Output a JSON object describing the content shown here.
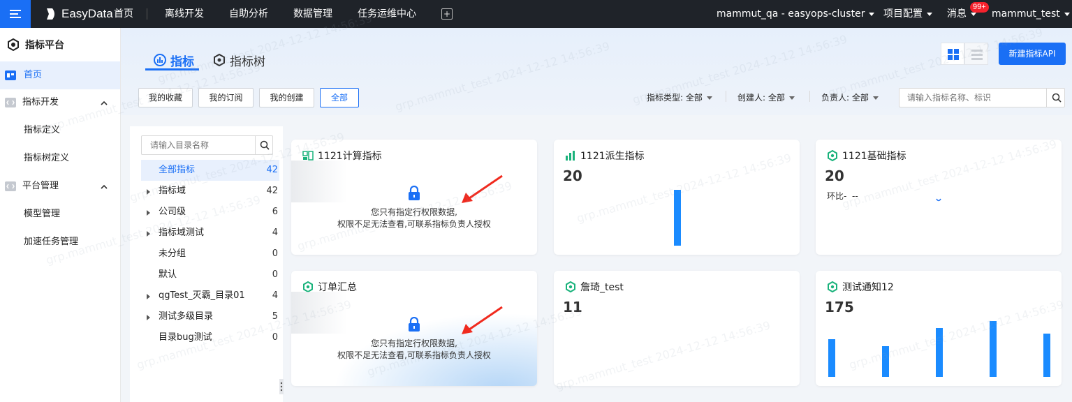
{
  "topbar": {
    "logo": "EasyData",
    "nav": [
      "首页",
      "离线开发",
      "自助分析",
      "数据管理",
      "任务运维中心"
    ],
    "cluster": "mammut_qa - easyops-cluster",
    "project_config": "项目配置",
    "messages": "消息",
    "message_badge": "99+",
    "user": "mammut_test"
  },
  "sidebar": {
    "title": "指标平台",
    "items": [
      {
        "label": "首页"
      },
      {
        "label": "指标开发"
      },
      {
        "label": "指标定义"
      },
      {
        "label": "指标树定义"
      },
      {
        "label": "平台管理"
      },
      {
        "label": "模型管理"
      },
      {
        "label": "加速任务管理"
      }
    ]
  },
  "tabs": [
    "指标",
    "指标树"
  ],
  "new_api_button": "新建指标API",
  "filters": {
    "buttons": [
      "我的收藏",
      "我的订阅",
      "我的创建",
      "全部"
    ],
    "selected": "全部",
    "dropdowns": [
      {
        "label": "指标类型:",
        "value": "全部"
      },
      {
        "label": "创建人:",
        "value": "全部"
      },
      {
        "label": "负责人:",
        "value": "全部"
      }
    ],
    "search_placeholder": "请输入指标名称、标识"
  },
  "directory": {
    "search_placeholder": "请输入目录名称",
    "items": [
      {
        "name": "全部指标",
        "count": "42",
        "expandable": false,
        "active": true
      },
      {
        "name": "指标域",
        "count": "42",
        "expandable": true
      },
      {
        "name": "公司级",
        "count": "6",
        "expandable": true
      },
      {
        "name": "指标域测试",
        "count": "4",
        "expandable": true
      },
      {
        "name": "未分组",
        "count": "0",
        "expandable": false
      },
      {
        "name": "默认",
        "count": "0",
        "expandable": false
      },
      {
        "name": "qgTest_灭霸_目录01",
        "count": "4",
        "expandable": true
      },
      {
        "name": "测试多级目录",
        "count": "5",
        "expandable": true
      },
      {
        "name": "目录bug测试",
        "count": "0",
        "expandable": false
      }
    ]
  },
  "cards": [
    {
      "title": "1121计算指标",
      "icon": "compute-indicator-icon",
      "locked": true,
      "lock_line1": "您只有指定行权限数据,",
      "lock_line2": "权限不足无法查看,可联系指标负责人授权"
    },
    {
      "title": "1121派生指标",
      "icon": "bar-chart-icon",
      "value": "20",
      "bars": [
        1
      ]
    },
    {
      "title": "1121基础指标",
      "icon": "gear-icon",
      "value": "20",
      "mom_label": "环比-",
      "mom_value": "--"
    },
    {
      "title": "订单汇总",
      "icon": "gear-icon",
      "locked": true,
      "lock_line1": "您只有指定行权限数据,",
      "lock_line2": "权限不足无法查看,可联系指标负责人授权"
    },
    {
      "title": "詹琦_test",
      "icon": "gear-icon",
      "value": "11"
    },
    {
      "title": "测试通知12",
      "icon": "gear-icon",
      "value": "175",
      "bars": [
        0.67,
        0.55,
        0.88,
        1,
        0.77
      ]
    }
  ],
  "watermark": "grp.mammut_test 2024-12-12 14:56:39",
  "colors": {
    "accent": "#1a6ff5",
    "topbar": "#1f2329",
    "bar": "#1a8bff",
    "badge": "#f5222d",
    "icon_green": "#19b27b"
  }
}
